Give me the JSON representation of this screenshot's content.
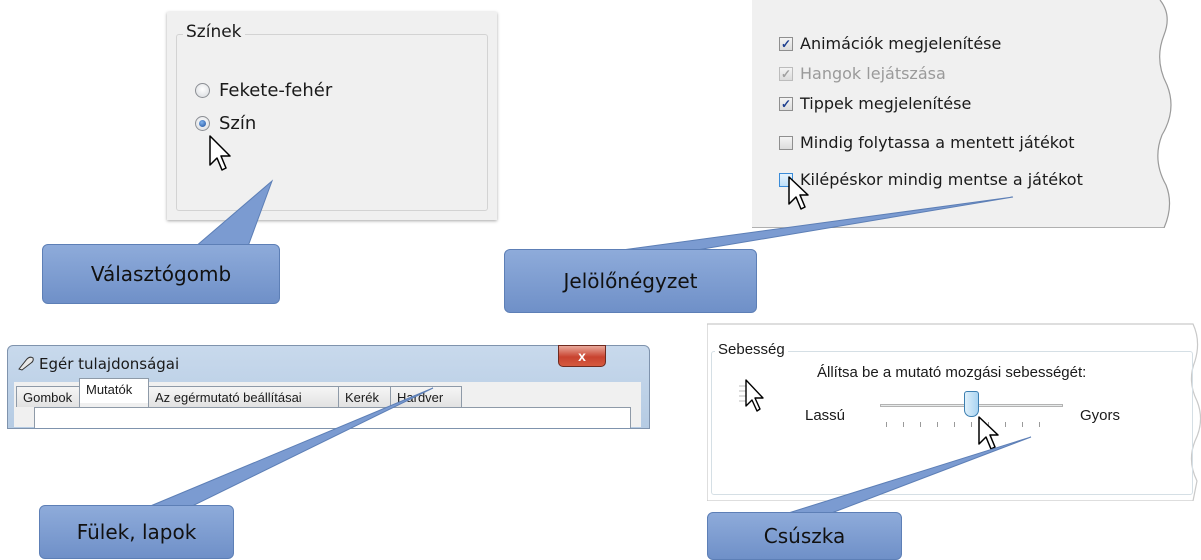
{
  "colors_panel": {
    "title": "Színek",
    "options": [
      {
        "label": "Fekete-fehér",
        "selected": false
      },
      {
        "label": "Szín",
        "selected": true
      }
    ]
  },
  "checkbox_panel": {
    "items": [
      {
        "label": "Animációk megjelenítése",
        "checked": true,
        "disabled": false
      },
      {
        "label": "Hangok lejátszása",
        "checked": true,
        "disabled": true
      },
      {
        "label": "Tippek megjelenítése",
        "checked": true,
        "disabled": false
      },
      {
        "label": "Mindig folytassa a mentett játékot",
        "checked": false,
        "disabled": false
      },
      {
        "label": "Kilépéskor mindig mentse a játékot",
        "checked": false,
        "disabled": false
      }
    ]
  },
  "mouse_window": {
    "title": "Egér tulajdonságai",
    "close_glyph": "x",
    "tabs": [
      "Gombok",
      "Mutatók",
      "Az egérmutató beállításai",
      "Kerék",
      "Hardver"
    ],
    "active_tab": 1
  },
  "speed_panel": {
    "title": "Sebesség",
    "description": "Állítsa be a mutató mozgási sebességét:",
    "min_label": "Lassú",
    "max_label": "Gyors",
    "slider_position": 0.5
  },
  "callouts": {
    "radio": "Választógomb",
    "checkbox": "Jelölőnégyzet",
    "tabs": "Fülek, lapok",
    "slider": "Csúszka"
  },
  "accent": "#7b9bd1"
}
